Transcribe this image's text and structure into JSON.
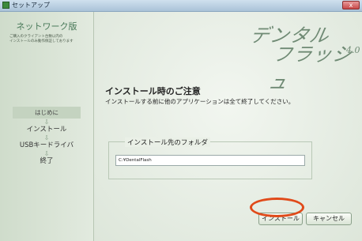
{
  "window": {
    "title": "セットアップ",
    "close_label": "x"
  },
  "sidebar": {
    "title": "ネットワーク版",
    "description": "ご購入のクライアント台数以内の\nインストールのみ動作保証しております",
    "steps": [
      {
        "label": "はじめに",
        "active": true
      },
      {
        "label": "インストール",
        "active": false
      },
      {
        "label": "USBキードライバ",
        "active": false
      },
      {
        "label": "終了",
        "active": false
      }
    ],
    "arrow_glyph": "⇩"
  },
  "logo": {
    "line1": "デンタル",
    "line2": "フラッシュ",
    "version": "4.0"
  },
  "main": {
    "notice_title": "インストール時のご注意",
    "notice_body": "インストールする前に他のアプリケーションは全て終了してください。",
    "folder_legend": "インストール先のフォルダ",
    "folder_value": "C:¥DentalFlash"
  },
  "buttons": {
    "install": "インストール",
    "cancel": "キャンセル"
  },
  "colors": {
    "highlight": "#e04a1a",
    "accent": "#6f8a74"
  }
}
